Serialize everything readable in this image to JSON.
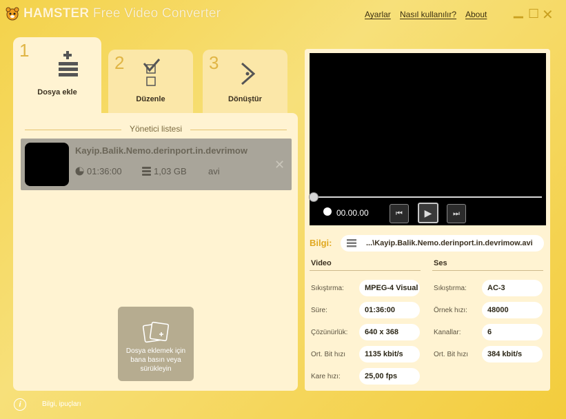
{
  "app": {
    "title_brand": "HAMSTER",
    "title_rest": "Free Video Converter",
    "menu": {
      "settings": "Ayarlar",
      "how_to": "Nasıl kullanılır?",
      "about": "About"
    }
  },
  "steps": [
    {
      "num": "1",
      "label": "Dosya ekle",
      "icon": "add-list-icon"
    },
    {
      "num": "2",
      "label": "Düzenle",
      "icon": "checkbox-icon"
    },
    {
      "num": "3",
      "label": "Dönüştür",
      "icon": "convert-arrow-icon"
    }
  ],
  "manager": {
    "title": "Yönetici listesi",
    "files": [
      {
        "name": "Kayip.Balik.Nemo.derinport.in.devrimow",
        "duration": "01:36:00",
        "size": "1,03 GB",
        "format": "avi"
      }
    ],
    "drop_zone": "Dosya eklemek için bana basın veya sürükleyin"
  },
  "footer": {
    "hint": "Bilgi, ipuçları"
  },
  "player": {
    "time": "00.00.00",
    "progress": 0
  },
  "info": {
    "label": "Bilgi:",
    "path": "...\\Kayip.Balik.Nemo.derinport.in.devrimow.avi",
    "video": {
      "title": "Video",
      "rows": [
        {
          "label": "Sıkıştırma:",
          "value": "MPEG-4 Visual"
        },
        {
          "label": "Süre:",
          "value": "01:36:00"
        },
        {
          "label": "Çözünürlük:",
          "value": "640 x 368"
        },
        {
          "label": "Ort. Bit hızı",
          "value": "1135 kbit/s"
        },
        {
          "label": "Kare hızı:",
          "value": "25,00 fps"
        }
      ]
    },
    "audio": {
      "title": "Ses",
      "rows": [
        {
          "label": "Sıkıştırma:",
          "value": "AC-3"
        },
        {
          "label": "Örnek hızı:",
          "value": "48000"
        },
        {
          "label": "Kanallar:",
          "value": "6"
        },
        {
          "label": "Ort. Bit hızı",
          "value": "384 kbit/s"
        }
      ]
    }
  },
  "colors": {
    "accent": "#e0a820",
    "panel": "#fff3d2",
    "background": "#f4d24a"
  }
}
